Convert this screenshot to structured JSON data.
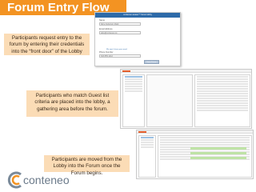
{
  "title": "Forum Entry Flow",
  "callouts": {
    "step1": "Participants request entry to the forum by entering their credentials into the “front door” of the Lobby",
    "step2": "Participants who match Guest list criteria are placed into the lobby, a gathering area before the forum.",
    "step3": "Participants are moved from the Lobby into the Forum once the Forum begins."
  },
  "login_form": {
    "header": "conteneo weave™ forum lobby",
    "name_label": "Name",
    "name_value": "Alice Anderson-Clark",
    "email_label": "Email Address",
    "email_value": "alice@conteneo.co",
    "note": "We won't share your email.",
    "phone_label": "Phone Number",
    "phone_value": "303-555-1212",
    "button_label": "Enter Forum"
  },
  "brand": {
    "name": "conteneo",
    "accent": "#f39322",
    "callout_bg": "#fbdcb6"
  },
  "icons": [
    "conteneo-logo-icon"
  ]
}
